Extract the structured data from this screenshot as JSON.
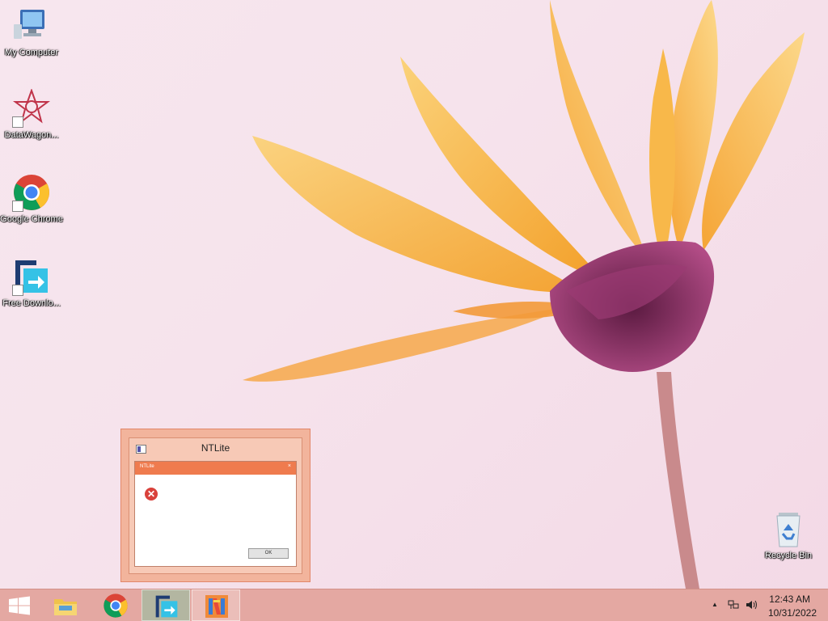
{
  "desktop_icons": [
    {
      "label": "My Computer",
      "icon": "computer-icon"
    },
    {
      "label": "DataWagon...",
      "icon": "datawagon-icon"
    },
    {
      "label": "Google Chrome",
      "icon": "chrome-icon"
    },
    {
      "label": "Free Downlo...",
      "icon": "download-manager-icon"
    },
    {
      "label": "Recycle Bin",
      "icon": "recycle-bin-icon"
    }
  ],
  "preview": {
    "window_title": "NTLite",
    "dialog_title": "NTLite",
    "dialog_close": "×",
    "error_glyph": "✕",
    "ok_label": "OK"
  },
  "taskbar": {
    "items": [
      {
        "name": "file-explorer",
        "icon": "folder-icon"
      },
      {
        "name": "chrome",
        "icon": "chrome-icon"
      },
      {
        "name": "free-download-manager",
        "icon": "download-manager-icon"
      },
      {
        "name": "ntlite",
        "icon": "ntlite-icon"
      }
    ],
    "tray_arrow": "▲",
    "clock_time": "12:43 AM",
    "clock_date": "10/31/2022"
  },
  "colors": {
    "taskbar": "#e4a8a2",
    "dialog_accent": "#ef7b4e",
    "petal": "#f6b042",
    "flower_center": "#7a2a5e"
  }
}
